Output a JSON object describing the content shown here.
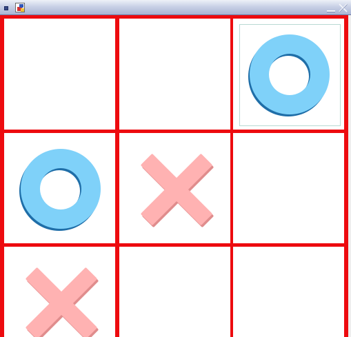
{
  "window": {
    "title": ""
  },
  "board": {
    "rows": 3,
    "cols": 3,
    "line_color": "#ed0b0f",
    "o_color": "#7fd1f9",
    "x_color": "#ffb2b2",
    "selected_cell": [
      0,
      2
    ],
    "cells": [
      [
        "",
        "",
        "O"
      ],
      [
        "O",
        "X",
        ""
      ],
      [
        "X",
        "",
        ""
      ]
    ]
  }
}
